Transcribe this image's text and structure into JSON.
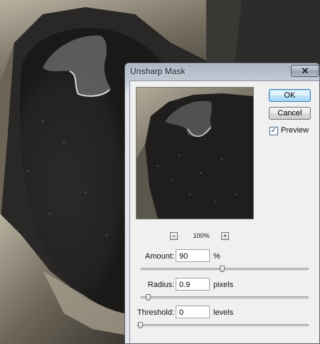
{
  "dialog": {
    "title": "Unsharp Mask",
    "close_label": "✕",
    "ok_label": "OK",
    "cancel_label": "Cancel",
    "preview_label": "Preview",
    "preview_checked": true,
    "zoom_minus": "−",
    "zoom_plus": "+",
    "zoom_level": "100%",
    "amount": {
      "label": "Amount:",
      "value": "90",
      "unit": "%",
      "slider_fraction": 0.47
    },
    "radius": {
      "label": "Radius:",
      "value": "0.9",
      "unit": "pixels",
      "slider_fraction": 0.03
    },
    "threshold": {
      "label": "Threshold:",
      "value": "0",
      "unit": "levels",
      "slider_fraction": 0.0
    }
  }
}
